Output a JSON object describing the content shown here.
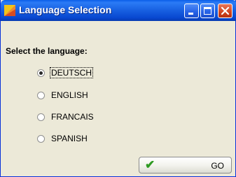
{
  "window": {
    "title": "Language Selection"
  },
  "prompt": "Select the language:",
  "options": [
    {
      "label": "DEUTSCH",
      "selected": true
    },
    {
      "label": "ENGLISH",
      "selected": false
    },
    {
      "label": "FRANCAIS",
      "selected": false
    },
    {
      "label": "SPANISH",
      "selected": false
    }
  ],
  "go_button": {
    "label": "GO",
    "icon": "checkmark-icon"
  },
  "colors": {
    "titlebar": "#0a5ee8",
    "window_bg": "#ece9d8",
    "check": "#2e9a22",
    "close_button": "#d0441f"
  }
}
